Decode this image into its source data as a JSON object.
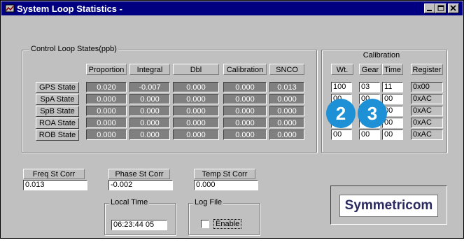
{
  "window": {
    "title": "System Loop Statistics -"
  },
  "control_loop": {
    "label": "Control Loop States(ppb)",
    "columns": [
      "Proportion",
      "Integral",
      "Dbl",
      "Calibration",
      "SNCO"
    ],
    "rows": [
      {
        "label": "GPS State",
        "values": [
          "0.020",
          "-0.007",
          "0.000",
          "0.000",
          "0.013"
        ]
      },
      {
        "label": "SpA State",
        "values": [
          "0.000",
          "0.000",
          "0.000",
          "0.000",
          "0.000"
        ]
      },
      {
        "label": "SpB State",
        "values": [
          "0.000",
          "0.000",
          "0.000",
          "0.000",
          "0.000"
        ]
      },
      {
        "label": "ROA State",
        "values": [
          "0.000",
          "0.000",
          "0.000",
          "0.000",
          "0.000"
        ]
      },
      {
        "label": "ROB State",
        "values": [
          "0.000",
          "0.000",
          "0.000",
          "0.000",
          "0.000"
        ]
      }
    ]
  },
  "calibration": {
    "title": "Calibration",
    "columns": [
      "Wt.",
      "Gear",
      "Time",
      "Register"
    ],
    "rows": [
      {
        "wt": "100",
        "gear": "03",
        "time": "11",
        "register": "0x00"
      },
      {
        "wt": "00",
        "gear": "00",
        "time": "00",
        "register": "0xAC"
      },
      {
        "wt": "00",
        "gear": "00",
        "time": "00",
        "register": "0xAC"
      },
      {
        "wt": "00",
        "gear": "00",
        "time": "00",
        "register": "0xAC"
      },
      {
        "wt": "00",
        "gear": "00",
        "time": "00",
        "register": "0xAC"
      }
    ]
  },
  "badges": [
    "2",
    "3"
  ],
  "fields": {
    "freq": {
      "label": "Freq St Corr",
      "value": "0.013"
    },
    "phase": {
      "label": "Phase St Corr",
      "value": "-0.002"
    },
    "temp": {
      "label": "Temp St Corr",
      "value": "0.000"
    }
  },
  "local_time": {
    "label": "Local Time",
    "value": "06:23:44  05"
  },
  "log_file": {
    "label": "Log File",
    "checkbox_label": "Enable"
  },
  "logo": {
    "text": "Symmetricom"
  },
  "colors": {
    "titlebar": "#000080",
    "face": "#c0c0c0",
    "cell": "#808080",
    "badge": "#1e90d6"
  }
}
